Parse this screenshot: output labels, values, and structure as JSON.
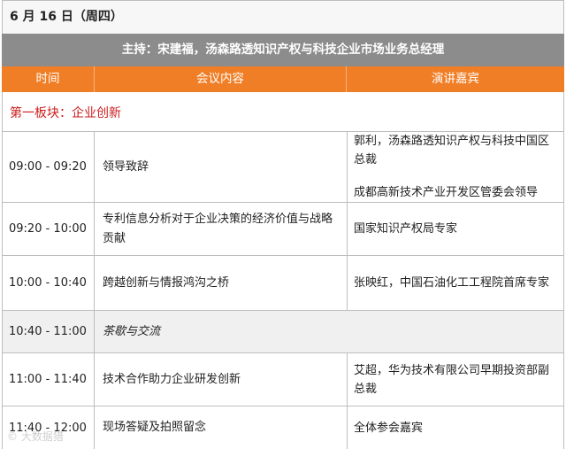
{
  "date": "6 月 16 日（周四）",
  "host": "主持：宋建福，汤森路透知识产权与科技企业市场业务总经理",
  "columns": {
    "time": "时间",
    "content": "会议内容",
    "speaker": "演讲嘉宾"
  },
  "section": "第一板块：企业创新",
  "rows": [
    {
      "time": "09:00 - 09:20",
      "content": "领导致辞",
      "speaker1": "郭利，汤森路透知识产权与科技中国区总裁",
      "speaker2": "成都高新技术产业开发区管委会领导"
    },
    {
      "time": "09:20 - 10:00",
      "content": "专利信息分析对于企业决策的经济价值与战略贡献",
      "speaker1": "国家知识产权局专家"
    },
    {
      "time": "10:00 - 10:40",
      "content": "跨越创新与情报鸿沟之桥",
      "speaker1": "张映红，中国石油化工工程院首席专家"
    },
    {
      "time": "10:40 - 11:00",
      "content": "茶歇与交流"
    },
    {
      "time": "11:00 - 11:40",
      "content": "技术合作助力企业研发创新",
      "speaker1": "艾超，华为技术有限公司早期投资部副总裁"
    },
    {
      "time": "11:40 - 12:00",
      "content": "现场答疑及拍照留念",
      "speaker1": "全体参会嘉宾"
    }
  ],
  "watermark": "© 大数据猎"
}
